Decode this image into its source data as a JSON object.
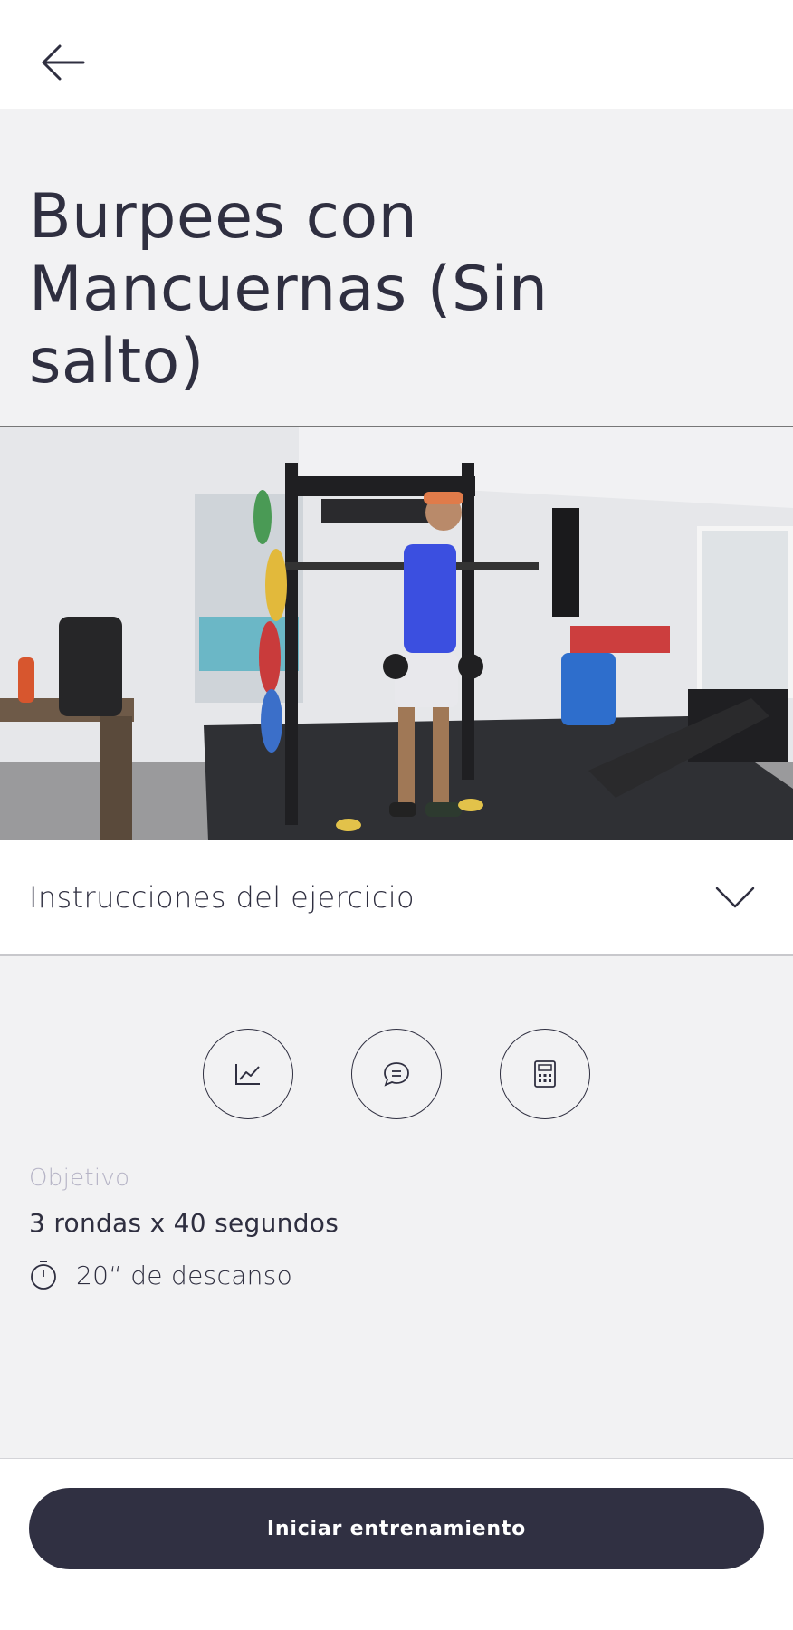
{
  "header": {
    "back_icon": "arrow-left-icon"
  },
  "exercise": {
    "title": "Burpees con Mancuernas (Sin salto)"
  },
  "video": {
    "content": "gym-video-thumbnail"
  },
  "instructions": {
    "label": "Instrucciones del ejercicio",
    "icon": "chevron-down-icon"
  },
  "actions": [
    {
      "icon": "chart-icon"
    },
    {
      "icon": "chat-icon"
    },
    {
      "icon": "calculator-icon"
    }
  ],
  "objective": {
    "label": "Objetivo",
    "value": "3 rondas x 40 segundos",
    "rest": "20“ de descanso",
    "rest_icon": "stopwatch-icon"
  },
  "footer": {
    "start_label": "Iniciar entrenamiento"
  },
  "colors": {
    "primary": "#303042",
    "text": "#2f2f40",
    "muted": "#b6b4c6",
    "background": "#f2f2f3"
  }
}
